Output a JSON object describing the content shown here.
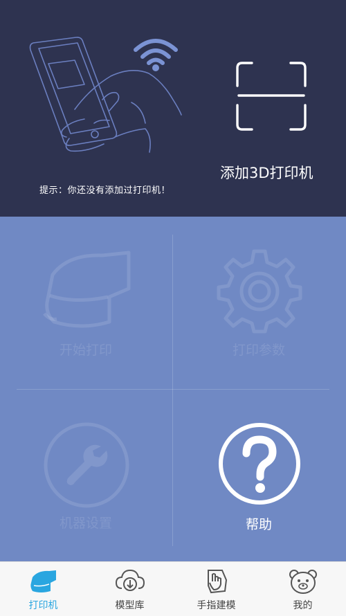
{
  "header": {
    "hint": "提示：你还没有添加过打印机！",
    "add_printer_label": "添加3D打印机"
  },
  "tiles": [
    {
      "label": "开始打印",
      "icon": "printer-nozzle-icon",
      "enabled": false
    },
    {
      "label": "打印参数",
      "icon": "gear-icon",
      "enabled": false
    },
    {
      "label": "机器设置",
      "icon": "wrench-icon",
      "enabled": false
    },
    {
      "label": "帮助",
      "icon": "question-icon",
      "enabled": true
    }
  ],
  "tabbar": {
    "items": [
      {
        "label": "打印机",
        "icon": "printer-icon",
        "active": true
      },
      {
        "label": "模型库",
        "icon": "cloud-download-icon",
        "active": false
      },
      {
        "label": "手指建模",
        "icon": "hand-gesture-icon",
        "active": false
      },
      {
        "label": "我的",
        "icon": "bear-face-icon",
        "active": false
      }
    ]
  },
  "colors": {
    "header_bg": "#2e3350",
    "grid_bg": "#7089c4",
    "accent": "#2aa6e0",
    "tabbar_bg": "#f7f7f7"
  }
}
